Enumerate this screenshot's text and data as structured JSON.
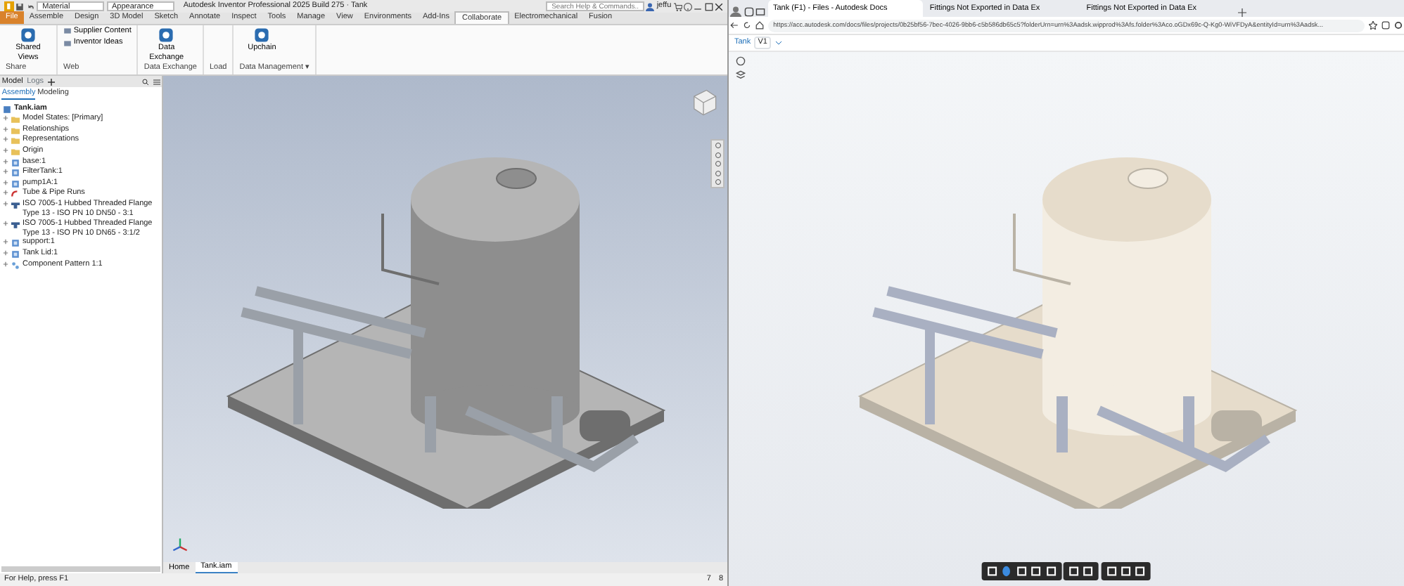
{
  "inventor": {
    "title": "Autodesk Inventor Professional 2025 Build 275 · Tank",
    "quick_access": {
      "material": "Material",
      "appearance": "Appearance"
    },
    "help_search": {
      "placeholder": "Search Help & Commands..."
    },
    "user": "jeffu",
    "ribbon_tabs": [
      {
        "label": "File",
        "selected": false,
        "kind": "file"
      },
      {
        "label": "Assemble",
        "selected": false,
        "kind": "tab"
      },
      {
        "label": "Design",
        "selected": false,
        "kind": "tab"
      },
      {
        "label": "3D Model",
        "selected": false,
        "kind": "tab"
      },
      {
        "label": "Sketch",
        "selected": false,
        "kind": "tab"
      },
      {
        "label": "Annotate",
        "selected": false,
        "kind": "tab"
      },
      {
        "label": "Inspect",
        "selected": false,
        "kind": "tab"
      },
      {
        "label": "Tools",
        "selected": false,
        "kind": "tab"
      },
      {
        "label": "Manage",
        "selected": false,
        "kind": "tab"
      },
      {
        "label": "View",
        "selected": false,
        "kind": "tab"
      },
      {
        "label": "Environments",
        "selected": false,
        "kind": "tab"
      },
      {
        "label": "Add-Ins",
        "selected": false,
        "kind": "tab"
      },
      {
        "label": "Collaborate",
        "selected": true,
        "kind": "tab"
      },
      {
        "label": "Electromechanical",
        "selected": false,
        "kind": "tab"
      },
      {
        "label": "Fusion",
        "selected": false,
        "kind": "tab"
      }
    ],
    "ribbon_groups": [
      {
        "label": "Share",
        "buttons": [
          {
            "label": "Shared Views",
            "kind": "large"
          }
        ]
      },
      {
        "label": "Web",
        "buttons": [
          {
            "label": "Supplier Content",
            "kind": "small"
          },
          {
            "label": "Inventor Ideas",
            "kind": "small"
          }
        ]
      },
      {
        "label": "Data Exchange",
        "buttons": [
          {
            "label": "Data Exchange",
            "kind": "large"
          }
        ]
      },
      {
        "label": "Load"
      },
      {
        "label": "Data Management ▾",
        "buttons": [
          {
            "label": "Upchain",
            "kind": "large"
          }
        ]
      }
    ],
    "model_browser": {
      "panel_tabs": [
        "Model",
        "Logs"
      ],
      "subtabs": [
        {
          "label": "Assembly",
          "selected": true
        },
        {
          "label": "Modeling",
          "selected": false
        }
      ],
      "root": "Tank.iam",
      "items": [
        {
          "label": "Model States: [Primary]",
          "kind": "folder"
        },
        {
          "label": "Relationships",
          "kind": "folder"
        },
        {
          "label": "Representations",
          "kind": "folder"
        },
        {
          "label": "Origin",
          "kind": "folder"
        },
        {
          "label": "base:1",
          "kind": "part"
        },
        {
          "label": "FilterTank:1",
          "kind": "part"
        },
        {
          "label": "pump1A:1",
          "kind": "part"
        },
        {
          "label": "Tube & Pipe Runs",
          "kind": "pipe"
        },
        {
          "label": "ISO 7005-1 Hubbed Threaded Flange Type 13 - ISO PN 10 DN50 - 3:1",
          "kind": "flange"
        },
        {
          "label": "ISO 7005-1 Hubbed Threaded Flange Type 13 - ISO PN 10 DN65 - 3:1/2",
          "kind": "flange"
        },
        {
          "label": "support:1",
          "kind": "part"
        },
        {
          "label": "Tank Lid:1",
          "kind": "part"
        },
        {
          "label": "Component Pattern 1:1",
          "kind": "pattern"
        }
      ]
    },
    "document_tabs": [
      {
        "label": "Home",
        "selected": false
      },
      {
        "label": "Tank.iam",
        "selected": true
      }
    ],
    "status_bar": {
      "hint": "For Help, press F1",
      "counts": [
        "7",
        "8"
      ]
    }
  },
  "browser": {
    "tabs": [
      {
        "label": "Tank (F1) - Files - Autodesk Docs",
        "selected": true
      },
      {
        "label": "Fittings Not Exported in Data Ex",
        "selected": false
      },
      {
        "label": "Fittings Not Exported in Data Ex",
        "selected": false
      }
    ],
    "url": "https://acc.autodesk.com/docs/files/projects/0b25bf56-7bec-4026-9bb6-c5b586db65c5?folderUrn=urn%3Aadsk.wipprod%3Afs.folder%3Aco.oGDx69c-Q-Kg0-WiVFDyA&entityId=urn%3Aadsk...",
    "header": {
      "title": "Tank",
      "version": "V1"
    }
  }
}
